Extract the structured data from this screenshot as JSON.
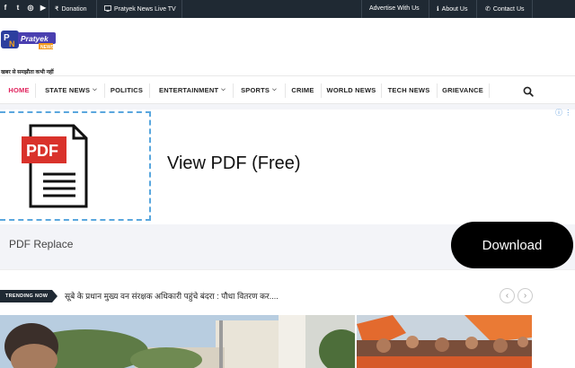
{
  "topbar": {
    "social_icons": [
      "facebook-icon",
      "twitter-icon",
      "instagram-icon",
      "youtube-icon"
    ],
    "social_glyphs": [
      "f",
      "t",
      "◎",
      "▶"
    ],
    "donation": "Donation",
    "live_tv": "Pratyek News Live TV",
    "advertise": "Advertise With Us",
    "about": "About Us",
    "contact": "Contact Us"
  },
  "logo": {
    "text": "Pratyek",
    "sub": "NEWS",
    "tagline": "खबर से समझौता कभी नहीं"
  },
  "nav": {
    "items": [
      "HOME",
      "STATE NEWS",
      "POLITICS",
      "ENTERTAINMENT",
      "SPORTS",
      "CRIME",
      "WORLD NEWS",
      "TECH NEWS",
      "GRIEVANCE"
    ],
    "active": "HOME"
  },
  "ad": {
    "pdf_label": "PDF",
    "title": "View PDF (Free)",
    "bottom_text": "PDF Replace",
    "button": "Download"
  },
  "trending": {
    "label": "TRENDING NOW",
    "headline": "सूबे के प्रधान मुख्य वन संरक्षक अधिकारी पहुंचे बंदरा : पौधा वितरण कर....",
    "prev": "‹",
    "next": "›"
  },
  "colors": {
    "topbar_bg": "#1f2933",
    "accent": "#e0245e",
    "pdf_red": "#d9322b"
  }
}
